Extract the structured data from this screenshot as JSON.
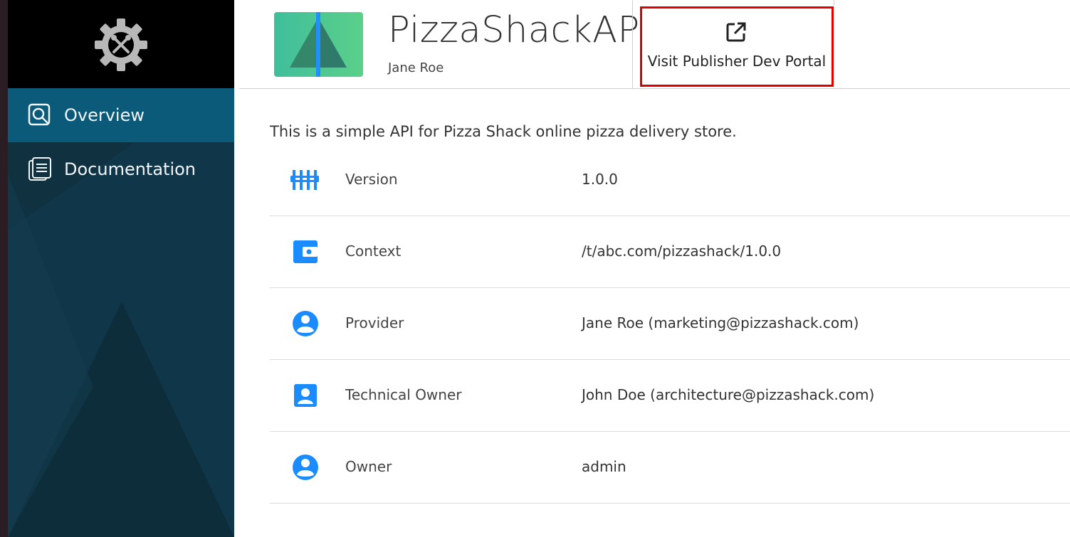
{
  "sidebar": {
    "brand_icon": "gear-tools-icon",
    "items": [
      {
        "label": "Overview",
        "icon": "overview-icon",
        "active": true
      },
      {
        "label": "Documentation",
        "icon": "documentation-icon",
        "active": false
      }
    ]
  },
  "header": {
    "api_name": "PizzaShackAPI",
    "provider": "Jane Roe",
    "portal_button": {
      "label": "Visit Publisher Dev Portal",
      "icon": "external-link-icon"
    }
  },
  "main": {
    "description": "This is a simple API for Pizza Shack online pizza delivery store.",
    "rows": [
      {
        "label": "Version",
        "value": "1.0.0",
        "icon": "version-icon"
      },
      {
        "label": "Context",
        "value": "/t/abc.com/pizzashack/1.0.0",
        "icon": "context-icon"
      },
      {
        "label": "Provider",
        "value": "Jane Roe (marketing@pizzashack.com)",
        "icon": "account-circle-icon"
      },
      {
        "label": "Technical Owner",
        "value": "John Doe (architecture@pizzashack.com)",
        "icon": "account-box-icon"
      },
      {
        "label": "Owner",
        "value": "admin",
        "icon": "account-circle-icon"
      }
    ]
  },
  "colors": {
    "sidebar_bg": "#0f3140",
    "sidebar_active": "#0b5a79",
    "icon_blue": "#1a8cff",
    "highlight_border": "#e00000"
  }
}
